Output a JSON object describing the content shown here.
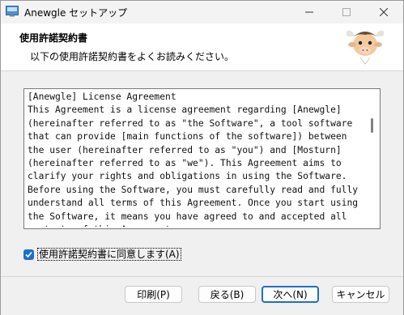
{
  "window": {
    "title": "Anewgle セットアップ"
  },
  "header": {
    "title": "使用許諾契約書",
    "subtitle": "以下の使用許諾契約書をよくお読みください。"
  },
  "license": {
    "text": "[Anewgle] License Agreement\nThis Agreement is a license agreement regarding [Anewgle] (hereinafter referred to as \"the Software\", a tool software that can provide [main functions of the software]) between the user (hereinafter referred to as \"you\") and [Mosturn] (hereinafter referred to as \"we\"). This Agreement aims to clarify your rights and obligations in using the Software. Before using the Software, you must carefully read and fully understand all terms of this Agreement. Once you start using the Software, it means you have agreed to and accepted all contents of this Agreement."
  },
  "agree": {
    "label": "使用許諾契約書に同意します(A)",
    "checked": true
  },
  "buttons": {
    "print": "印刷(P)",
    "back": "戻る(B)",
    "next": "次へ(N)",
    "cancel": "キャンセル"
  },
  "colors": {
    "accent": "#1e6fc8"
  }
}
